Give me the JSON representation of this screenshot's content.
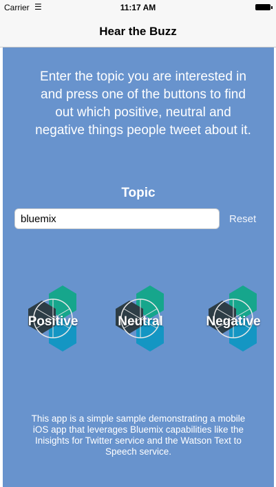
{
  "status_bar": {
    "carrier": "Carrier",
    "time": "11:17 AM"
  },
  "nav": {
    "title": "Hear the Buzz"
  },
  "intro": "Enter the topic you are interested in and press one of the buttons to find out which positive, neutral and negative things people tweet about it.",
  "topic": {
    "label": "Topic",
    "value": "bluemix",
    "reset_label": "Reset"
  },
  "buttons": [
    {
      "label": "Positive"
    },
    {
      "label": "Neutral"
    },
    {
      "label": "Negative"
    }
  ],
  "footer": "This app is a simple sample demonstrating a mobile iOS app that leverages Bluemix capabilities like the Inisights for Twitter service and the Watson Text to Speech service.",
  "colors": {
    "background": "#6893cd",
    "hex_dark": "#2d3d46",
    "hex_green": "#16a68c",
    "hex_blue": "#1496c3"
  },
  "icons": [
    "wifi-icon",
    "battery-icon",
    "hexagon-cluster-icon"
  ]
}
